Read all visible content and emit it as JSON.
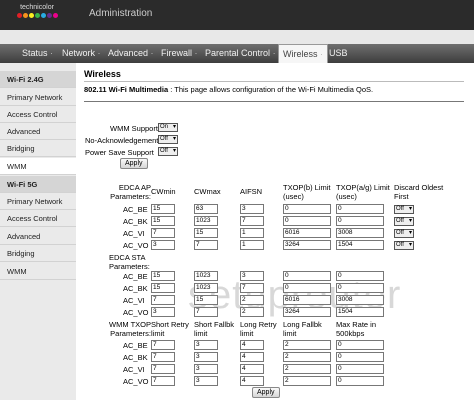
{
  "header": {
    "logo_text": "technicolor",
    "logo_colors": [
      "#e21f26",
      "#f6921e",
      "#fcee21",
      "#39b54a",
      "#29abe2",
      "#662d91",
      "#ec008c"
    ],
    "title": "Administration"
  },
  "nav": {
    "items": [
      "Status",
      "Network",
      "Advanced",
      "Firewall",
      "Parental Control",
      "Wireless",
      "USB"
    ],
    "separator": "·",
    "active": "Wireless"
  },
  "sidebar": {
    "items": [
      "Wi-Fi 2.4G",
      "Primary Network",
      "Access Control",
      "Advanced",
      "Bridging",
      "WMM",
      "Wi-Fi 5G",
      "Primary Network",
      "Access Control",
      "Advanced",
      "Bridging",
      "WMM"
    ],
    "active_index": 5
  },
  "page": {
    "title": "Wireless",
    "desc_label": "802.11 Wi-Fi Multimedia",
    "desc_sep": ":",
    "desc_text": "This page allows configuration of the Wi-Fi Multimedia QoS."
  },
  "settings": {
    "wmm_support_label": "WMM Support",
    "wmm_support_value": "On",
    "no_ack_label": "No-Acknowledgement",
    "no_ack_value": "Off",
    "power_save_label": "Power Save Support",
    "power_save_value": "Off",
    "apply_label": "Apply"
  },
  "edca_ap": {
    "section_label": "EDCA AP Parameters:",
    "headers": [
      "CWmin",
      "CWmax",
      "AIFSN",
      "TXOP(b) Limit (usec)",
      "TXOP(a/g) Limit (usec)",
      "Discard Oldest First"
    ],
    "rows": [
      {
        "name": "AC_BE",
        "cwmin": "15",
        "cwmax": "63",
        "aifsn": "3",
        "txop_b": "0",
        "txop_ag": "0",
        "discard": "Off"
      },
      {
        "name": "AC_BK",
        "cwmin": "15",
        "cwmax": "1023",
        "aifsn": "7",
        "txop_b": "0",
        "txop_ag": "0",
        "discard": "Off"
      },
      {
        "name": "AC_VI",
        "cwmin": "7",
        "cwmax": "15",
        "aifsn": "1",
        "txop_b": "6016",
        "txop_ag": "3008",
        "discard": "Off"
      },
      {
        "name": "AC_VO",
        "cwmin": "3",
        "cwmax": "7",
        "aifsn": "1",
        "txop_b": "3264",
        "txop_ag": "1504",
        "discard": "Off"
      }
    ]
  },
  "edca_sta": {
    "section_label": "EDCA STA Parameters:",
    "rows": [
      {
        "name": "AC_BE",
        "cwmin": "15",
        "cwmax": "1023",
        "aifsn": "3",
        "txop_b": "0",
        "txop_ag": "0"
      },
      {
        "name": "AC_BK",
        "cwmin": "15",
        "cwmax": "1023",
        "aifsn": "7",
        "txop_b": "0",
        "txop_ag": "0"
      },
      {
        "name": "AC_VI",
        "cwmin": "7",
        "cwmax": "15",
        "aifsn": "2",
        "txop_b": "6016",
        "txop_ag": "3008"
      },
      {
        "name": "AC_VO",
        "cwmin": "3",
        "cwmax": "7",
        "aifsn": "2",
        "txop_b": "3264",
        "txop_ag": "1504"
      }
    ]
  },
  "txop": {
    "section_label": "WMM TXOP Parameters:",
    "headers": [
      "Short Retry limit",
      "Short Fallbk limit",
      "Long Retry limit",
      "Long Fallbk limit",
      "Max Rate in 500kbps"
    ],
    "rows": [
      {
        "name": "AC_BE",
        "short_retry": "7",
        "short_fallbk": "3",
        "long_retry": "4",
        "long_fallbk": "2",
        "max_rate": "0"
      },
      {
        "name": "AC_BK",
        "short_retry": "7",
        "short_fallbk": "3",
        "long_retry": "4",
        "long_fallbk": "2",
        "max_rate": "0"
      },
      {
        "name": "AC_VI",
        "short_retry": "7",
        "short_fallbk": "3",
        "long_retry": "4",
        "long_fallbk": "2",
        "max_rate": "0"
      },
      {
        "name": "AC_VO",
        "short_retry": "7",
        "short_fallbk": "3",
        "long_retry": "4",
        "long_fallbk": "2",
        "max_rate": "0"
      }
    ],
    "apply_label": "Apply"
  },
  "watermark": "setuprouter"
}
